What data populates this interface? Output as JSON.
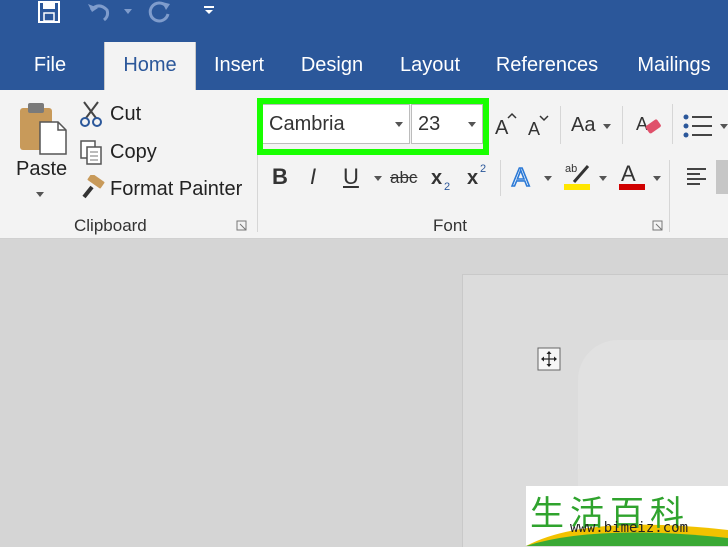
{
  "tabs": [
    "File",
    "Home",
    "Insert",
    "Design",
    "Layout",
    "References",
    "Mailings"
  ],
  "clipboard": {
    "paste": "Paste",
    "cut": "Cut",
    "copy": "Copy",
    "format_painter": "Format Painter",
    "group_label": "Clipboard"
  },
  "font": {
    "font_name": "Cambria",
    "font_size": "23",
    "group_label": "Font",
    "bold": "B",
    "italic": "I",
    "underline": "U",
    "strikethrough": "abc",
    "change_case": "Aa"
  },
  "watermark": {
    "text": "生活百科",
    "url": "www.bimeiz.com"
  },
  "colors": {
    "accent": "#2b579a",
    "highlight_box": "#18ff00",
    "font_color": "#d00000",
    "highlighter": "#ffe600"
  }
}
